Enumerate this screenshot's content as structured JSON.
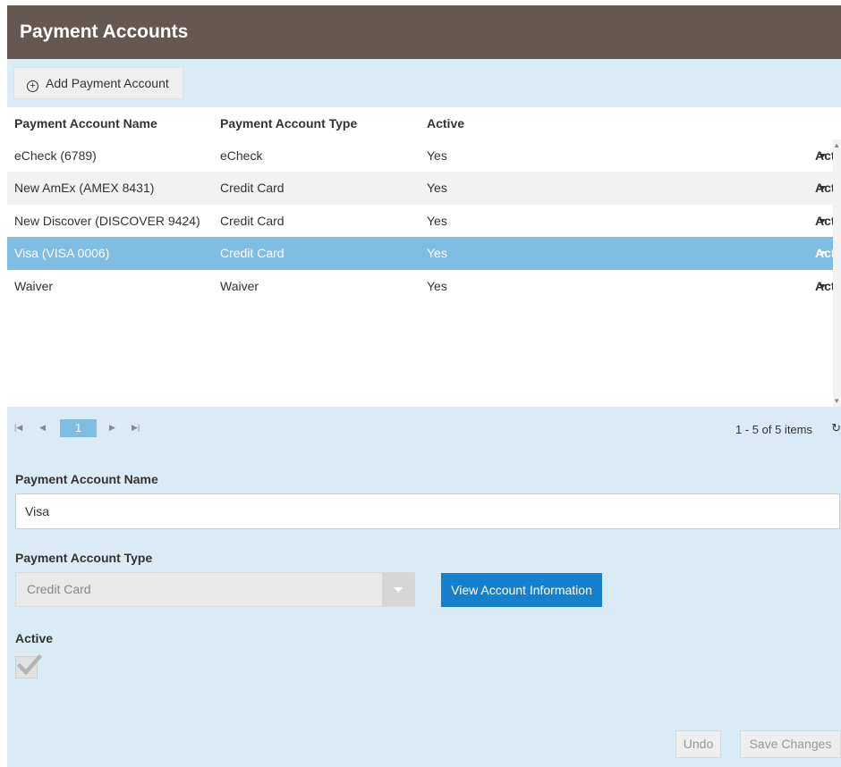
{
  "window": {
    "title": "Payment Accounts"
  },
  "toolbar": {
    "add_label": "Add Payment Account"
  },
  "grid": {
    "columns": [
      "Payment Account Name",
      "Payment Account Type",
      "Active"
    ],
    "rows": [
      {
        "name": "eCheck (6789)",
        "type": "eCheck",
        "active": "Yes",
        "actions": "Actions"
      },
      {
        "name": "New AmEx (AMEX 8431)",
        "type": "Credit Card",
        "active": "Yes",
        "actions": "Actions"
      },
      {
        "name": "New Discover (DISCOVER 9424)",
        "type": "Credit Card",
        "active": "Yes",
        "actions": "Actions"
      },
      {
        "name": "Visa (VISA 0006)",
        "type": "Credit Card",
        "active": "Yes",
        "actions": "Actions"
      },
      {
        "name": "Waiver",
        "type": "Waiver",
        "active": "Yes",
        "actions": "Actions"
      }
    ],
    "selected_row": 3
  },
  "pager": {
    "current_page": "1",
    "info": "1 - 5 of 5 items"
  },
  "form": {
    "name_label": "Payment Account Name",
    "name_value": "Visa",
    "type_label": "Payment Account Type",
    "type_value": "Credit Card",
    "view_button": "View Account Information",
    "active_label": "Active",
    "active_checked": true,
    "undo_label": "Undo",
    "save_label": "Save Changes"
  },
  "colors": {
    "header": "#655752",
    "panel": "#dbebf5",
    "selected_row": "#7fbde2",
    "primary_button": "#1680cc"
  }
}
